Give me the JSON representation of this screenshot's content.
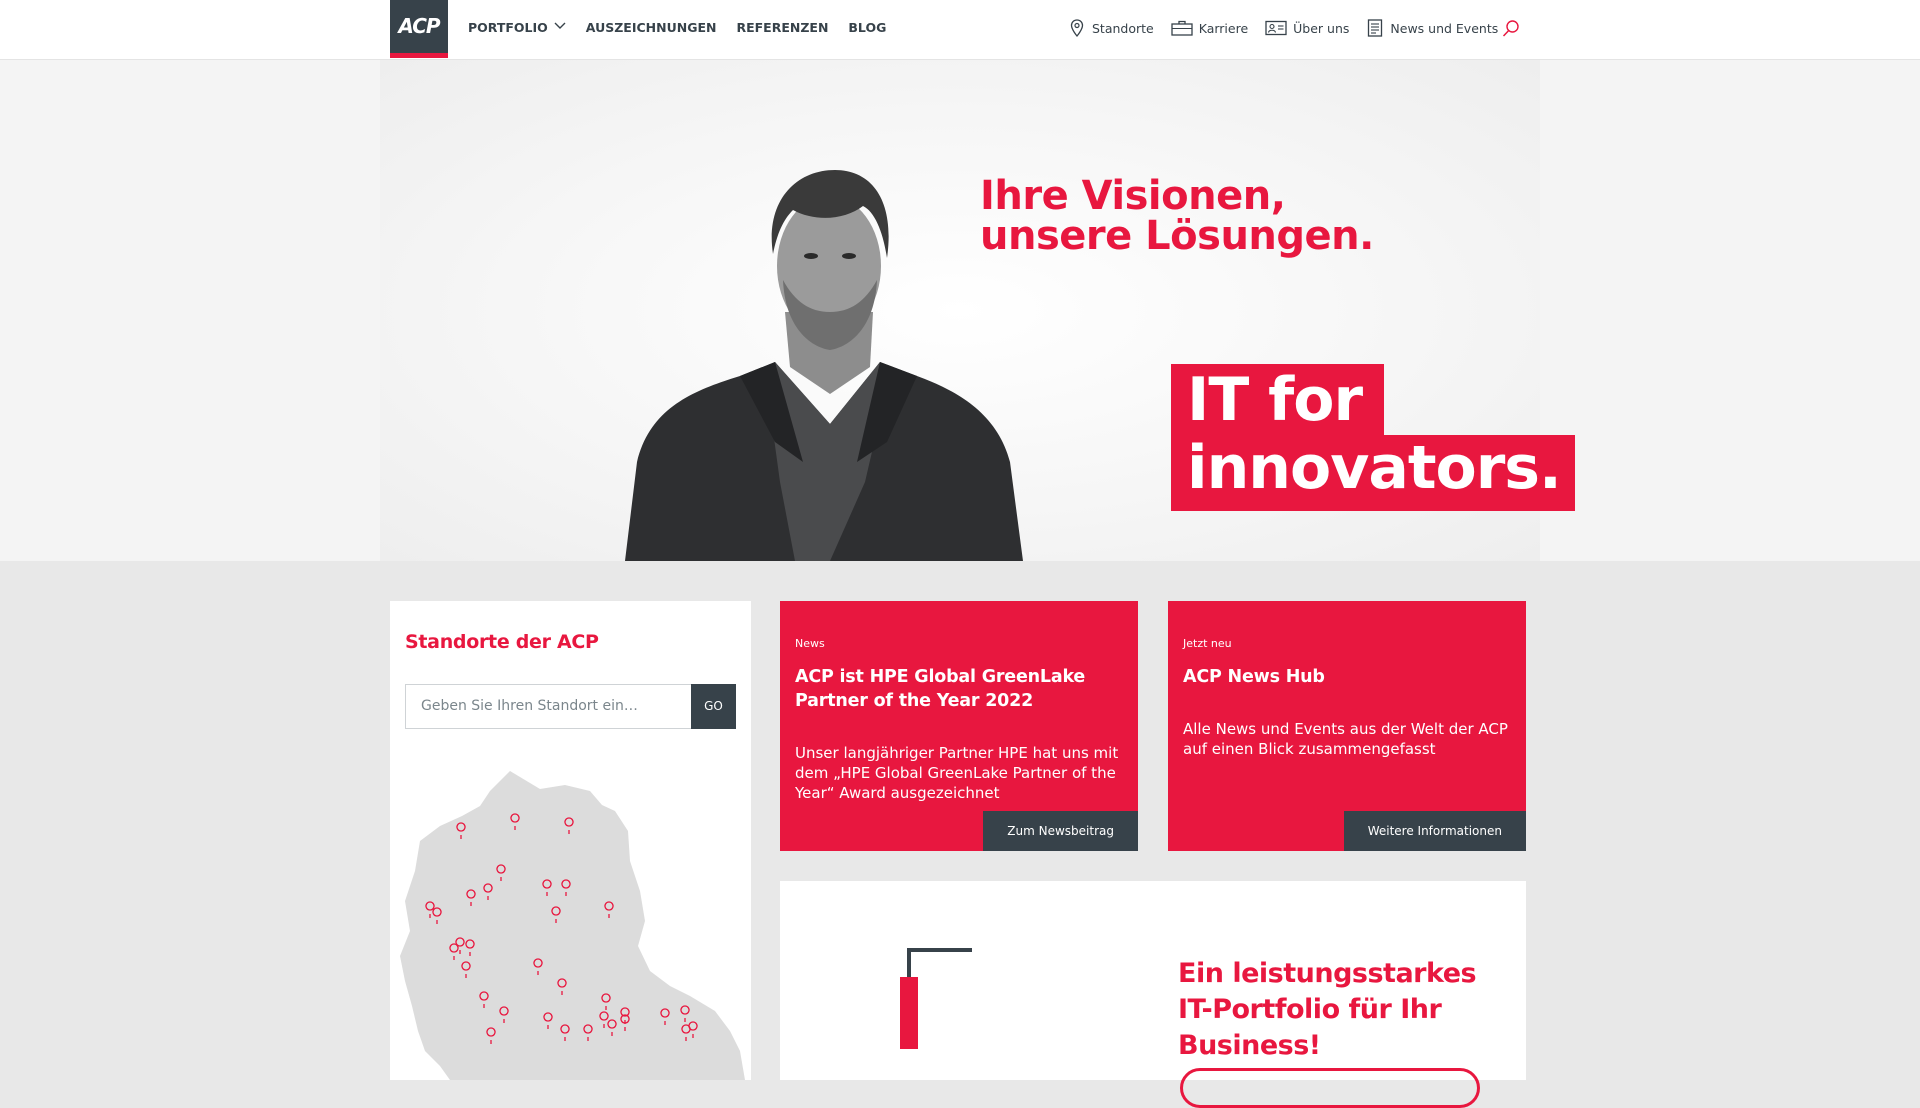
{
  "header": {
    "logo_text": "ACP",
    "nav": [
      {
        "label": "PORTFOLIO",
        "has_dropdown": true
      },
      {
        "label": "AUSZEICHNUNGEN"
      },
      {
        "label": "REFERENZEN"
      },
      {
        "label": "BLOG"
      }
    ],
    "meta": [
      {
        "label": "Standorte",
        "icon": "map-pin-icon"
      },
      {
        "label": "Karriere",
        "icon": "briefcase-icon"
      },
      {
        "label": "Über uns",
        "icon": "id-card-icon"
      },
      {
        "label": "News und Events",
        "icon": "newspaper-icon"
      }
    ],
    "search_icon": "search-icon"
  },
  "hero": {
    "headline_line1": "Ihre Visionen,",
    "headline_line2": "unsere Lösungen.",
    "claim_line1": "IT for",
    "claim_line2": "innovators."
  },
  "locations": {
    "title": "Standorte der ACP",
    "input_placeholder": "Geben Sie Ihren Standort ein…",
    "go_label": "GO"
  },
  "teasers": [
    {
      "kicker": "News",
      "title": "ACP ist HPE Global GreenLake Partner of the Year 2022",
      "text": "Unser langjähriger Partner HPE hat uns mit dem „HPE Global GreenLake Partner of the Year“ Award ausgezeichnet",
      "button": "Zum Newsbeitrag"
    },
    {
      "kicker": "Jetzt neu",
      "title": "ACP News Hub",
      "text": "Alle News und Events aus der Welt der ACP auf einen Blick zusammengefasst",
      "button": "Weitere Informationen"
    }
  ],
  "portfolio": {
    "headline_line1": "Ein leistungsstarkes",
    "headline_line2": "IT-Portfolio für Ihr Business!"
  },
  "colors": {
    "accent": "#e8173f",
    "dark": "#37424a",
    "background": "#e8e8e8"
  }
}
